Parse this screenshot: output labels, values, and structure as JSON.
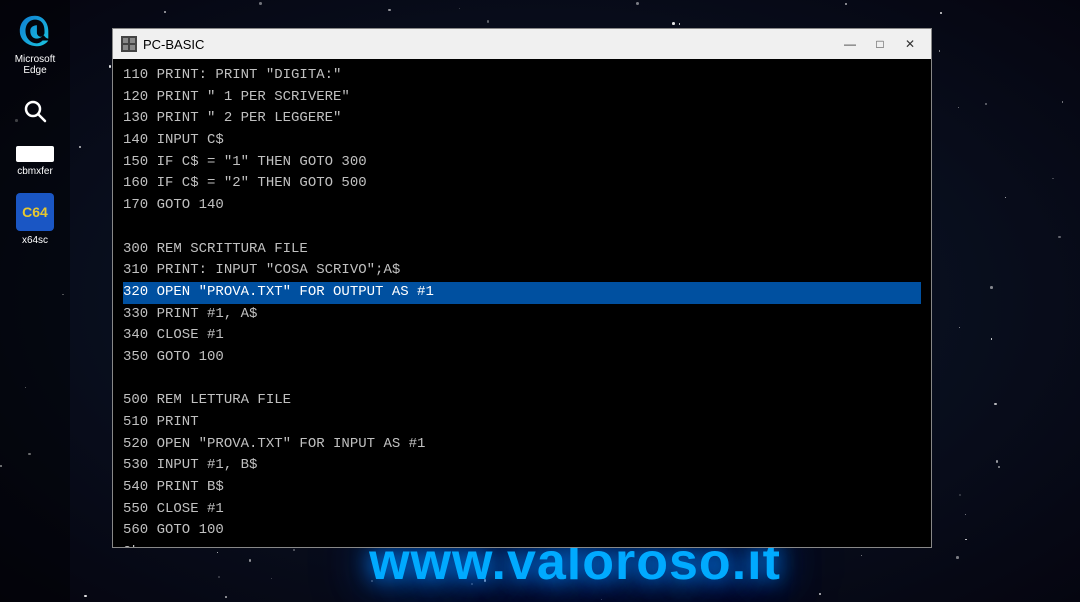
{
  "background": {
    "color": "#050510"
  },
  "sidebar": {
    "items": [
      {
        "name": "microsoft-edge",
        "label": "Microsoft\nEdge",
        "icon_type": "edge"
      },
      {
        "name": "search",
        "label": "",
        "icon_type": "search"
      },
      {
        "name": "cbmxfer",
        "label": "CBMXfer",
        "icon_type": "bar"
      },
      {
        "name": "x64sc",
        "label": "x64sc",
        "icon_type": "c64"
      }
    ]
  },
  "window": {
    "title": "PC-BASIC",
    "icon": "PC",
    "controls": {
      "minimize": "—",
      "maximize": "□",
      "close": "✕"
    },
    "code_lines": [
      {
        "text": "110 PRINT: PRINT \"DIGITA:\"",
        "highlighted": false
      },
      {
        "text": "120 PRINT \" 1 PER SCRIVERE\"",
        "highlighted": false
      },
      {
        "text": "130 PRINT \" 2 PER LEGGERE\"",
        "highlighted": false
      },
      {
        "text": "140 INPUT C$",
        "highlighted": false
      },
      {
        "text": "150 IF C$ = \"1\" THEN GOTO 300",
        "highlighted": false
      },
      {
        "text": "160 IF C$ = \"2\" THEN GOTO 500",
        "highlighted": false
      },
      {
        "text": "170 GOTO 140",
        "highlighted": false
      },
      {
        "text": "",
        "highlighted": false
      },
      {
        "text": "300 REM SCRITTURA FILE",
        "highlighted": false
      },
      {
        "text": "310 PRINT: INPUT \"COSA SCRIVO\";A$",
        "highlighted": false
      },
      {
        "text": "320 OPEN \"PROVA.TXT\" FOR OUTPUT AS #1",
        "highlighted": true
      },
      {
        "text": "330 PRINT #1, A$",
        "highlighted": false
      },
      {
        "text": "340 CLOSE #1",
        "highlighted": false
      },
      {
        "text": "350 GOTO 100",
        "highlighted": false
      },
      {
        "text": "",
        "highlighted": false
      },
      {
        "text": "500 REM LETTURA FILE",
        "highlighted": false
      },
      {
        "text": "510 PRINT",
        "highlighted": false
      },
      {
        "text": "520 OPEN \"PROVA.TXT\" FOR INPUT AS #1",
        "highlighted": false
      },
      {
        "text": "530 INPUT #1, B$",
        "highlighted": false
      },
      {
        "text": "540 PRINT B$",
        "highlighted": false
      },
      {
        "text": "550 CLOSE #1",
        "highlighted": false
      },
      {
        "text": "560 GOTO 100",
        "highlighted": false
      },
      {
        "text": "Ok",
        "highlighted": false
      },
      {
        "text": "_",
        "highlighted": false
      }
    ]
  },
  "watermark": {
    "text": "www.valoroso.it"
  }
}
